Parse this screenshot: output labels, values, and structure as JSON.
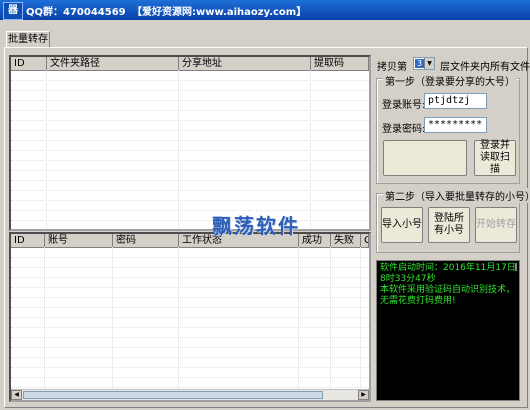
{
  "window": {
    "title": "QQ群：470044569",
    "site_label": "【爱好资源网:www.aihaozy.com】"
  },
  "tab": {
    "label": "批量转存"
  },
  "top_table": {
    "columns": [
      "ID",
      "文件夹路径",
      "分享地址",
      "提取码"
    ]
  },
  "bottom_table": {
    "columns": [
      "ID",
      "账号",
      "密码",
      "工作状态",
      "成功",
      "失败",
      "C"
    ]
  },
  "copy_option": {
    "prefix_label": "拷贝第",
    "selected_value": "3",
    "suffix_label": "层文件夹内所有文件夹"
  },
  "step1": {
    "legend": "第一步（登录要分享的大号）",
    "account_label": "登录账号:",
    "account_value": "ptjdtzj",
    "password_label": "登录密码:",
    "password_value": "*********",
    "login_scan_button": "登录并读取扫描"
  },
  "step2": {
    "legend": "第二步（导入要批量转存的小号）",
    "import_button": "导入小号",
    "login_all_button": "登陆所有小号",
    "start_button": "开始转存"
  },
  "log": {
    "text": "软件启动时间：2016年11月17日8时33分47秒\n本软件采用验证码自动识别技术，无需花费打码费用!"
  },
  "watermark": "飘荡软件"
}
